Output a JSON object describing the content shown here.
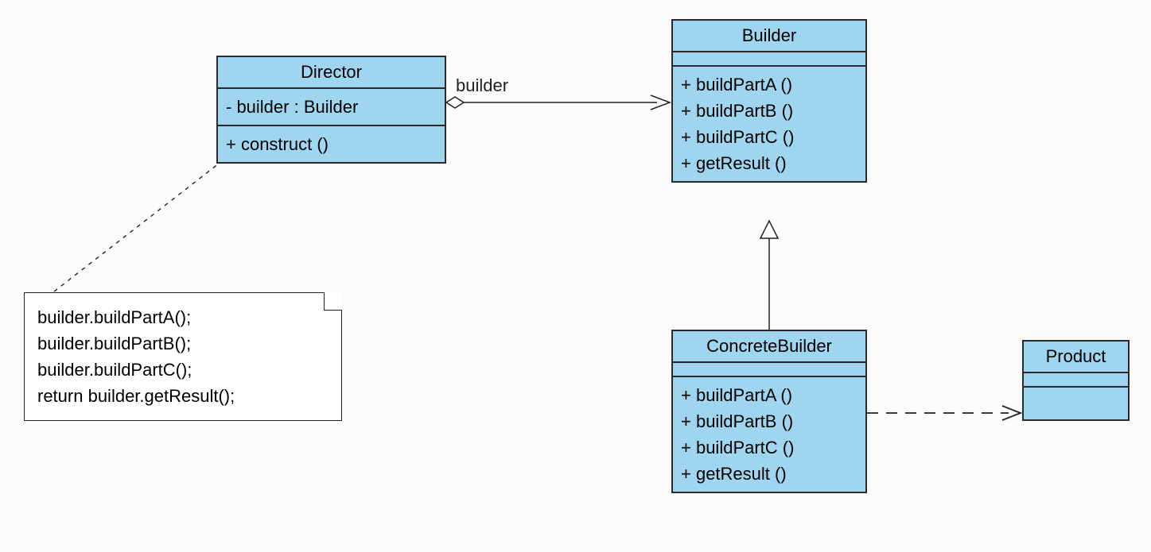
{
  "classes": {
    "director": {
      "name": "Director",
      "attributes": [
        "- builder : Builder"
      ],
      "operations": [
        "+ construct ()"
      ]
    },
    "builder": {
      "name": "Builder",
      "operations": [
        "+ buildPartA ()",
        "+ buildPartB ()",
        "+ buildPartC ()",
        "+ getResult ()"
      ]
    },
    "concreteBuilder": {
      "name": "ConcreteBuilder",
      "operations": [
        "+ buildPartA ()",
        "+ buildPartB ()",
        "+ buildPartC ()",
        "+ getResult ()"
      ]
    },
    "product": {
      "name": "Product"
    }
  },
  "note": {
    "lines": [
      "builder.buildPartA();",
      "builder.buildPartB();",
      "builder.buildPartC();",
      "return builder.getResult();"
    ]
  },
  "labels": {
    "builderAssoc": "builder"
  }
}
